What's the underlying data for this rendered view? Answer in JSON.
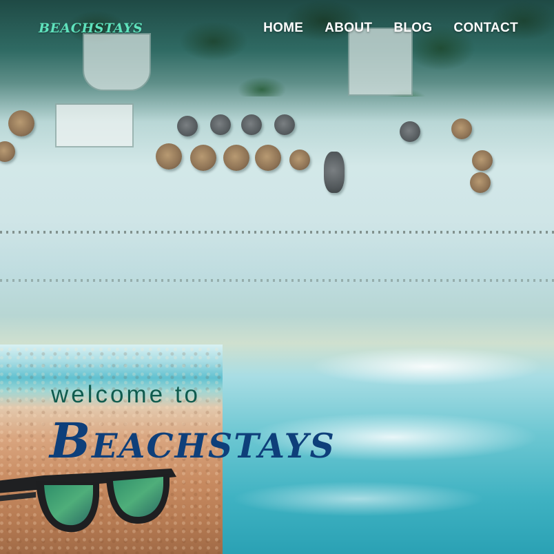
{
  "brand": {
    "logo_text": "BEACHSTAYS",
    "logo_color": "#5fe3bd"
  },
  "nav": {
    "items": [
      {
        "label": "HOME"
      },
      {
        "label": "ABOUT"
      },
      {
        "label": "BLOG"
      },
      {
        "label": "CONTACT"
      }
    ]
  },
  "hero": {
    "welcome_text": "welcome to",
    "title_text": "Beachstays",
    "welcome_color": "#0f5b4e",
    "title_color": "#0e3f7a"
  },
  "images": {
    "background": "aerial-beach-photo",
    "inset": "sunglasses-on-sand-photo"
  }
}
